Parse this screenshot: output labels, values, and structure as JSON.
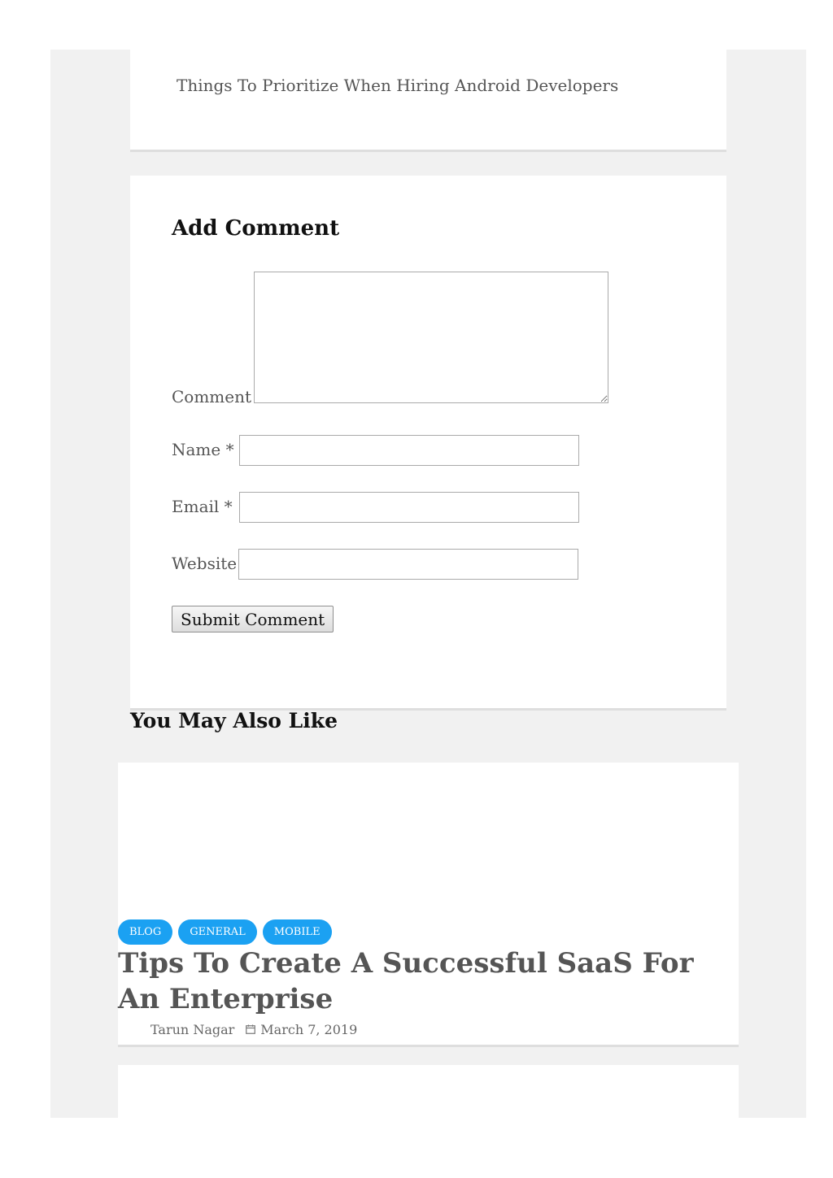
{
  "related_post": {
    "title": "Things To Prioritize When Hiring Android Developers"
  },
  "comment_form": {
    "heading": "Add Comment",
    "comment_label": "Comment",
    "comment_value": "",
    "name_label": "Name *",
    "name_value": "",
    "email_label": "Email *",
    "email_value": "",
    "website_label": "Website",
    "website_value": "",
    "submit_label": "Submit Comment"
  },
  "related_section": {
    "heading": "You May Also Like",
    "post": {
      "tags": [
        "BLOG",
        "GENERAL",
        "MOBILE"
      ],
      "title": "Tips To Create A Successful SaaS For An Enterprise",
      "author": "Tarun Nagar",
      "date": "March 7, 2019",
      "date_icon": "calendar-icon"
    }
  },
  "colors": {
    "tag_background": "#1ba1f2",
    "page_background": "#f1f1f1"
  }
}
